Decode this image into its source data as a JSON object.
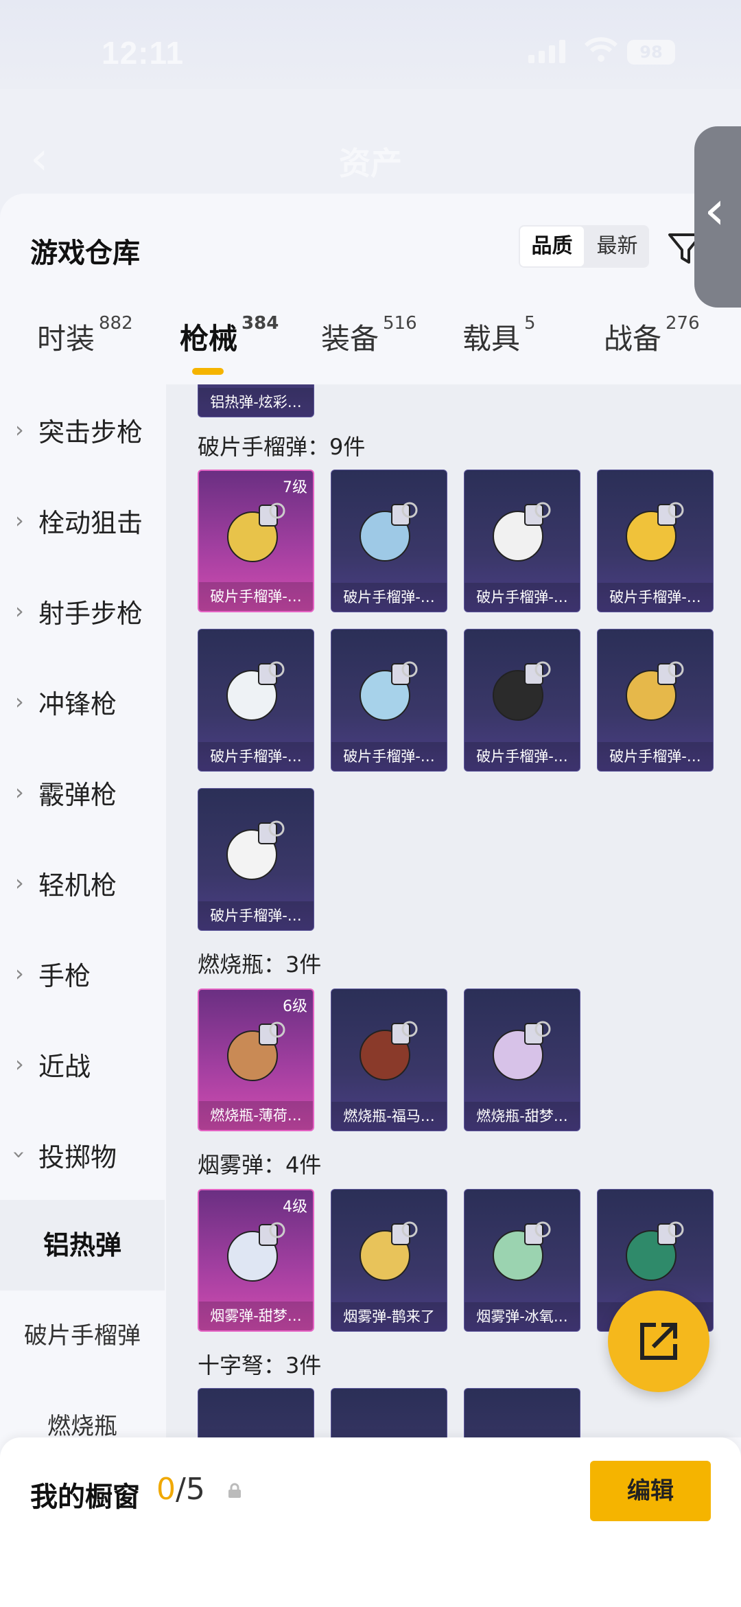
{
  "status": {
    "time": "12:11",
    "battery": "98"
  },
  "nav": {
    "back_glyph": "‹",
    "title": "资产"
  },
  "sheet": {
    "title": "游戏仓库",
    "sort_options": [
      "品质",
      "最新"
    ],
    "active_sort": "品质"
  },
  "tabs": [
    {
      "label": "时装",
      "count": "882"
    },
    {
      "label": "枪械",
      "count": "384"
    },
    {
      "label": "装备",
      "count": "516"
    },
    {
      "label": "载具",
      "count": "5"
    },
    {
      "label": "战备",
      "count": "276"
    }
  ],
  "active_tab": "枪械",
  "sidebar": {
    "categories": [
      "突击步枪",
      "栓动狙击",
      "射手步枪",
      "冲锋枪",
      "霰弹枪",
      "轻机枪",
      "手枪",
      "近战",
      "投掷物"
    ],
    "subcategories": [
      "铝热弹",
      "破片手榴弹",
      "燃烧瓶"
    ],
    "active_sub": "铝热弹"
  },
  "content": {
    "partial_top_name": "铝热弹-炫彩…",
    "sections": [
      {
        "title": "破片手榴弹：9件",
        "items": [
          {
            "name": "破片手榴弹-…",
            "level": "7级",
            "quality": "gold"
          },
          {
            "name": "破片手榴弹-…",
            "level": "",
            "quality": "purple"
          },
          {
            "name": "破片手榴弹-…",
            "level": "",
            "quality": "purple"
          },
          {
            "name": "破片手榴弹-…",
            "level": "",
            "quality": "purple"
          },
          {
            "name": "破片手榴弹-…",
            "level": "",
            "quality": "purple"
          },
          {
            "name": "破片手榴弹-…",
            "level": "",
            "quality": "purple"
          },
          {
            "name": "破片手榴弹-…",
            "level": "",
            "quality": "purple"
          },
          {
            "name": "破片手榴弹-…",
            "level": "",
            "quality": "purple"
          },
          {
            "name": "破片手榴弹-…",
            "level": "",
            "quality": "purple"
          }
        ]
      },
      {
        "title": "燃烧瓶：3件",
        "items": [
          {
            "name": "燃烧瓶-薄荷…",
            "level": "6级",
            "quality": "gold"
          },
          {
            "name": "燃烧瓶-福马…",
            "level": "",
            "quality": "purple"
          },
          {
            "name": "燃烧瓶-甜梦…",
            "level": "",
            "quality": "purple"
          }
        ]
      },
      {
        "title": "烟雾弹：4件",
        "items": [
          {
            "name": "烟雾弹-甜梦…",
            "level": "4级",
            "quality": "gold"
          },
          {
            "name": "烟雾弹-鹊来了",
            "level": "",
            "quality": "purple"
          },
          {
            "name": "烟雾弹-冰氧…",
            "level": "",
            "quality": "purple"
          },
          {
            "name": "烟雾弹-…",
            "level": "",
            "quality": "purple"
          }
        ]
      },
      {
        "title": "十字弩：3件",
        "items": []
      }
    ]
  },
  "bottom": {
    "title": "我的橱窗",
    "current": "0",
    "total": "/5",
    "edit_label": "编辑"
  },
  "colors": {
    "accent": "#f5b400",
    "gold_card": "#d24cb0",
    "purple_card": "#3a3768"
  }
}
